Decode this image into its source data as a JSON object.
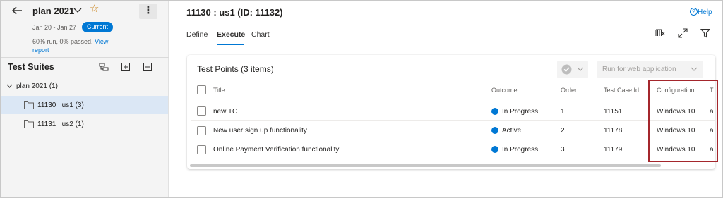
{
  "plan": {
    "title": "plan 2021",
    "dates": "Jan 20 - Jan 27",
    "status_badge": "Current",
    "stats_text": "60% run, 0% passed.",
    "view_link_1": "View",
    "view_link_2": "report"
  },
  "suites": {
    "title": "Test Suites",
    "items": [
      {
        "label": "plan 2021 (1)"
      },
      {
        "label": "11130 : us1 (3)"
      },
      {
        "label": "11131 : us2 (1)"
      }
    ]
  },
  "header": {
    "title": "11130 : us1 (ID: 11132)",
    "help": "Help",
    "help_icon_glyph": "?"
  },
  "tabs": [
    {
      "label": "Define"
    },
    {
      "label": "Execute"
    },
    {
      "label": "Chart"
    }
  ],
  "test_points": {
    "title": "Test Points (3 items)",
    "run_button": "Run for web application",
    "columns": [
      "Title",
      "Outcome",
      "Order",
      "Test Case Id",
      "Configuration",
      "T"
    ],
    "rows": [
      {
        "title": "new TC",
        "outcome": "In Progress",
        "order": "1",
        "test_case_id": "11151",
        "configuration": "Windows 10",
        "tester": "a"
      },
      {
        "title": "New user sign up functionality",
        "outcome": "Active",
        "order": "2",
        "test_case_id": "11178",
        "configuration": "Windows 10",
        "tester": "a"
      },
      {
        "title": "Online Payment Verification functionality",
        "outcome": "In Progress",
        "order": "3",
        "test_case_id": "11179",
        "configuration": "Windows 10",
        "tester": "a"
      }
    ]
  },
  "colors": {
    "accent": "#0078d4",
    "highlight_box": "#a4262c",
    "star": "#c87d0e",
    "selected_row": "#dbe7f5"
  },
  "icons": [
    "back-arrow-icon",
    "chevron-down-icon",
    "star-icon",
    "more-vertical-icon",
    "show-parent-icon",
    "new-suite-icon",
    "collapse-icon",
    "folder-icon",
    "help-icon",
    "column-options-icon",
    "fullscreen-icon",
    "filter-icon",
    "checkmark-circle-icon"
  ]
}
